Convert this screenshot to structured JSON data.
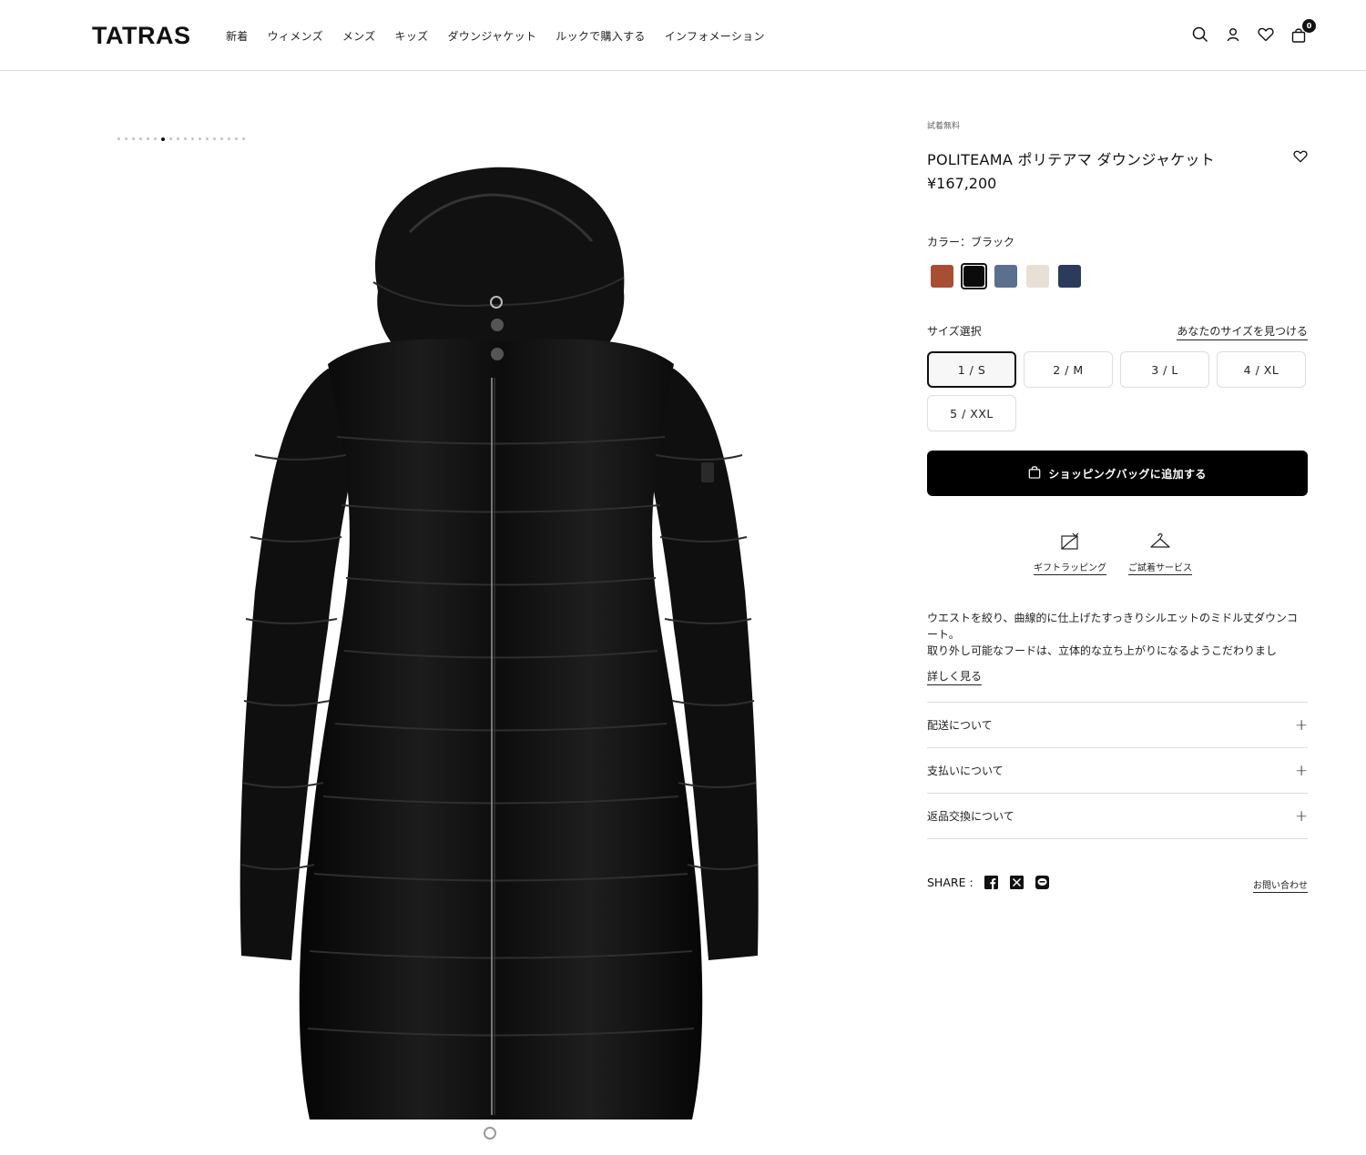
{
  "header": {
    "logo": "TATRAS",
    "nav": [
      "新着",
      "ウィメンズ",
      "メンズ",
      "キッズ",
      "ダウンジャケット",
      "ルックで購入する",
      "インフォメーション"
    ],
    "icons": [
      "search-icon",
      "account-icon",
      "heart-icon",
      "bag-icon"
    ],
    "cart_count": "0"
  },
  "gallery": {
    "total_images": 18,
    "active_index": 6
  },
  "product": {
    "badge": "試着無料",
    "title": "POLITEAMA ポリテアマ ダウンジャケット",
    "price": "¥167,200",
    "color_label": "カラー：ブラック",
    "colors": [
      {
        "name": "brown",
        "hex": "#a84f33"
      },
      {
        "name": "black",
        "hex": "#0b0b0b",
        "selected": true
      },
      {
        "name": "slate-blue",
        "hex": "#5a708e"
      },
      {
        "name": "beige",
        "hex": "#e8e0d5"
      },
      {
        "name": "navy",
        "hex": "#2b3b5c"
      }
    ],
    "size_label": "サイズ選択",
    "find_size": "あなたのサイズを見つける",
    "sizes": [
      "1 / S",
      "2 / M",
      "3 / L",
      "4 / XL",
      "5 / XXL"
    ],
    "selected_size": "1 / S",
    "add_to_bag": "ショッピングバッグに追加する",
    "services": [
      {
        "label": "ギフトラッピング",
        "icon": "gift-wrapping-icon"
      },
      {
        "label": "ご試着サービス",
        "icon": "hanger-icon"
      }
    ],
    "description": "ウエストを絞り、曲線的に仕上げたすっきりシルエットのミドル丈ダウンコート。\n取り外し可能なフードは、立体的な立ち上がりになるようこだわりまし",
    "more": "詳しく見る",
    "accordion": [
      "配送について",
      "支払いについて",
      "返品交換について"
    ],
    "share_label": "SHARE :",
    "share_icons": [
      "facebook-icon",
      "x-icon",
      "line-icon"
    ],
    "contact": "お問い合わせ"
  }
}
